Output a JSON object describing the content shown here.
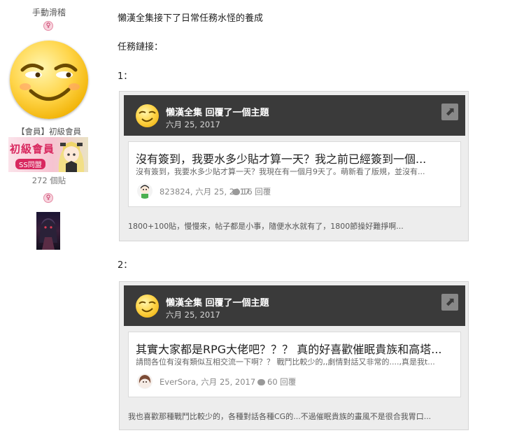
{
  "user": {
    "name": "手動滑稽",
    "gender_symbol": "♀",
    "rank": "【會員】初級會員",
    "rank_badge_text": "初級會員",
    "rank_badge_sub": "SS同盟",
    "post_count": "272 個貼"
  },
  "post": {
    "line1": "懶漢全集接下了日常任務水怪的養成",
    "task_link_label": "任務鏈接：",
    "item1_label": "1：",
    "item2_label": "2："
  },
  "cards": [
    {
      "author_action": "懶漢全集 回覆了一個主題",
      "date": "六月 25, 2017",
      "thread_title": "沒有簽到，我要水多少貼才算一天？我之前已經簽到一個...",
      "thread_excerpt": "沒有簽到，我要水多少貼才算一天？我現在有一個月9天了。萌新看了版規，並沒有...",
      "poster_line": "823824, 六月 25, 2017",
      "reply_count": "16 回覆",
      "reply_snippet": "1800+100貼，慢慢來，帖子都是小事，隨便水水就有了，1800節操好難掙啊...",
      "open_icon": "external-link-icon"
    },
    {
      "author_action": "懶漢全集 回覆了一個主題",
      "date": "六月 25, 2017",
      "thread_title": "其實大家都是RPG大佬吧？？？ 真的好喜歡催眠貴族和高塔...",
      "thread_excerpt": "請問各位有沒有類似互相交流一下啊？？ 戰鬥比較少的,,劇情對話又非常的....,真是我t...",
      "poster_line": "EverSora, 六月 25, 2017",
      "reply_count": "60 回覆",
      "reply_snippet": "我也喜歡那種戰鬥比較少的，各種對話各種CG的...不過催眠貴族的畫風不是很合我胃口...",
      "open_icon": "external-link-icon"
    }
  ],
  "colors": {
    "card_header": "#3a3a3a",
    "card_body": "#ededed",
    "accent_pink": "#d8285f"
  }
}
